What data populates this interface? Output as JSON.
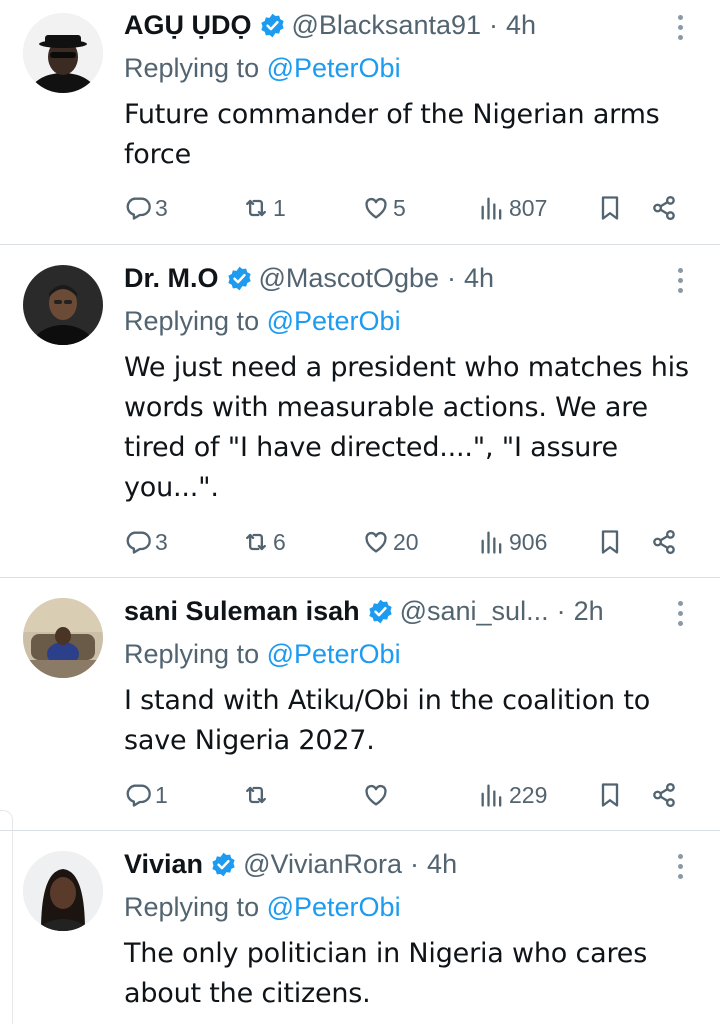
{
  "tweets": [
    {
      "name": "AGỤ ỤDỌ",
      "handle": "@Blacksanta91",
      "time": "4h",
      "reply_prefix": "Replying to",
      "reply_to": "@PeterObi",
      "text": "Future commander of the Nigerian arms force",
      "replies": "3",
      "retweets": "1",
      "likes": "5",
      "views": "807"
    },
    {
      "name": "Dr. M.O",
      "handle": "@MascotOgbe",
      "time": "4h",
      "reply_prefix": "Replying to",
      "reply_to": "@PeterObi",
      "text": "We just need a president who matches his words with measurable actions. We are tired of \"I have directed....\", \"I assure you...\".",
      "replies": "3",
      "retweets": "6",
      "likes": "20",
      "views": "906"
    },
    {
      "name": "sani Suleman isah",
      "handle": "@sani_sul...",
      "time": "2h",
      "reply_prefix": "Replying to",
      "reply_to": "@PeterObi",
      "text": "I stand with Atiku/Obi in the coalition to save Nigeria 2027.",
      "replies": "1",
      "retweets": "",
      "likes": "",
      "views": "229"
    },
    {
      "name": "Vivian",
      "handle": "@VivianRora",
      "time": "4h",
      "reply_prefix": "Replying to",
      "reply_to": "@PeterObi",
      "text": "The only politician in Nigeria who cares about the citizens."
    }
  ],
  "icons": {
    "reply": "speech-bubble-icon",
    "retweet": "retweet-icon",
    "like": "heart-icon",
    "views": "bar-chart-icon",
    "bookmark": "bookmark-icon",
    "share": "share-icon",
    "verified": "verified-badge-icon",
    "more": "more-vertical-icon"
  },
  "colors": {
    "accent": "#1d9bf0",
    "secondary_text": "#536471",
    "primary_text": "#0f1419",
    "divider": "#dadfe3"
  }
}
